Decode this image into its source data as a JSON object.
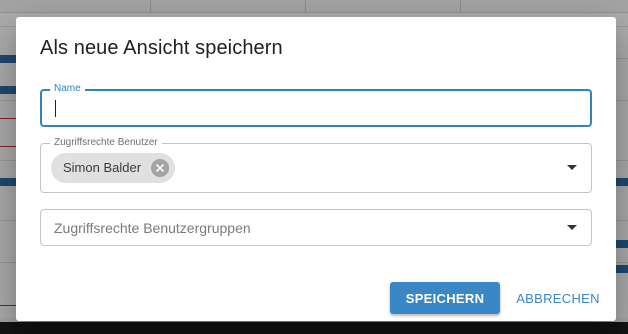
{
  "dialog": {
    "title": "Als neue Ansicht speichern",
    "name_field": {
      "label": "Name",
      "value": ""
    },
    "users_field": {
      "label": "Zugriffsrechte Benutzer",
      "chips": [
        {
          "label": "Simon Balder"
        }
      ]
    },
    "groups_field": {
      "placeholder": "Zugriffsrechte Benutzergruppen"
    },
    "actions": {
      "save_label": "SPEICHERN",
      "cancel_label": "ABBRECHEN"
    }
  },
  "colors": {
    "accent": "#3a87c5",
    "focus_border": "#2f84c2",
    "chip_background": "#e0e0e0",
    "overlay": "rgba(0,0,0,0.32)"
  },
  "icons": {
    "chip_remove": "cancel-circle-icon",
    "dropdown": "arrow-drop-down-icon"
  }
}
